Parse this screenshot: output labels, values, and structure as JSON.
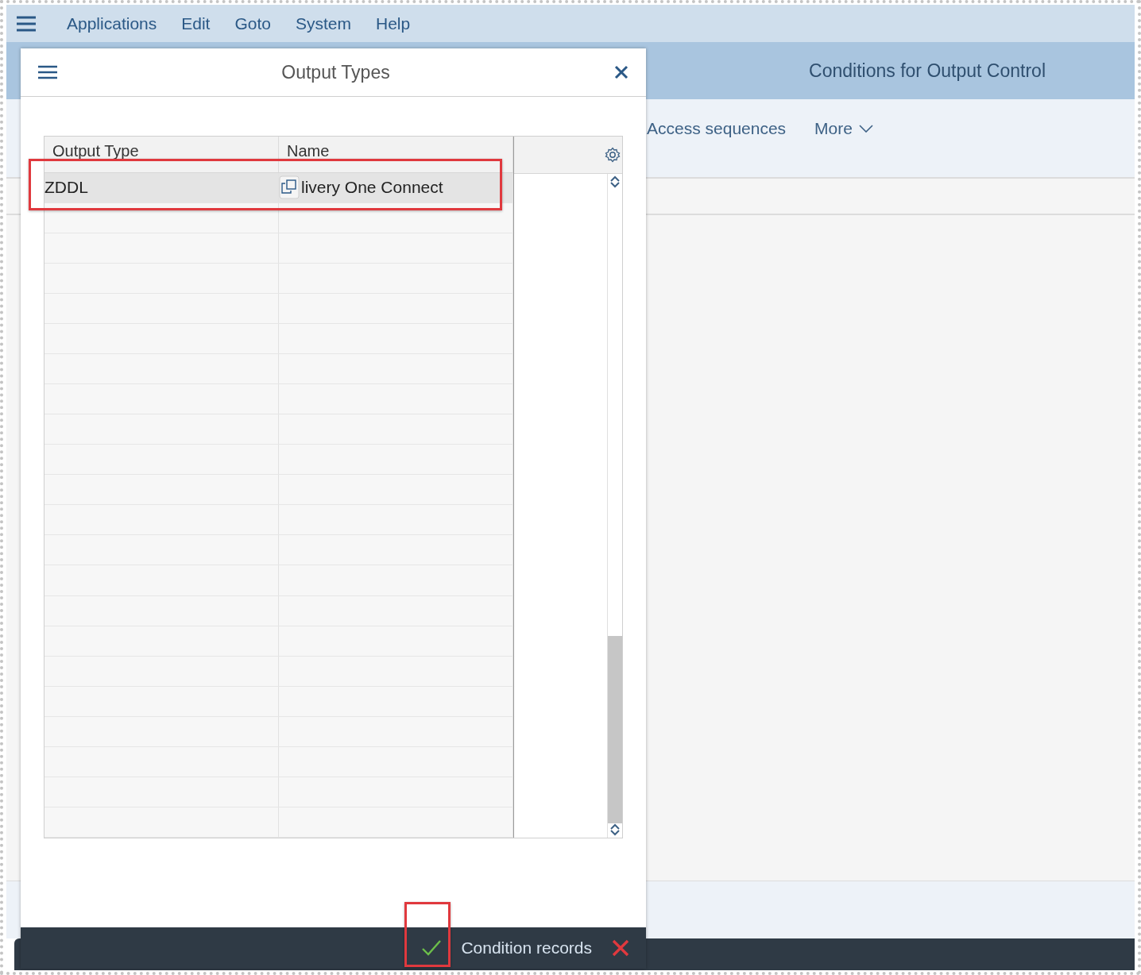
{
  "menu_bar": {
    "items": [
      "Applications",
      "Edit",
      "Goto",
      "System",
      "Help"
    ]
  },
  "app": {
    "title": "Conditions for Output Control",
    "toolbar": [
      "Access sequences",
      "More"
    ]
  },
  "dialog": {
    "title": "Output Types",
    "table": {
      "columns": [
        "Output Type",
        "Name"
      ],
      "rows": [
        {
          "output_type": "ZDDL",
          "name": "livery One Connect",
          "selected": true
        }
      ]
    },
    "footer": {
      "button": "Condition records"
    }
  }
}
